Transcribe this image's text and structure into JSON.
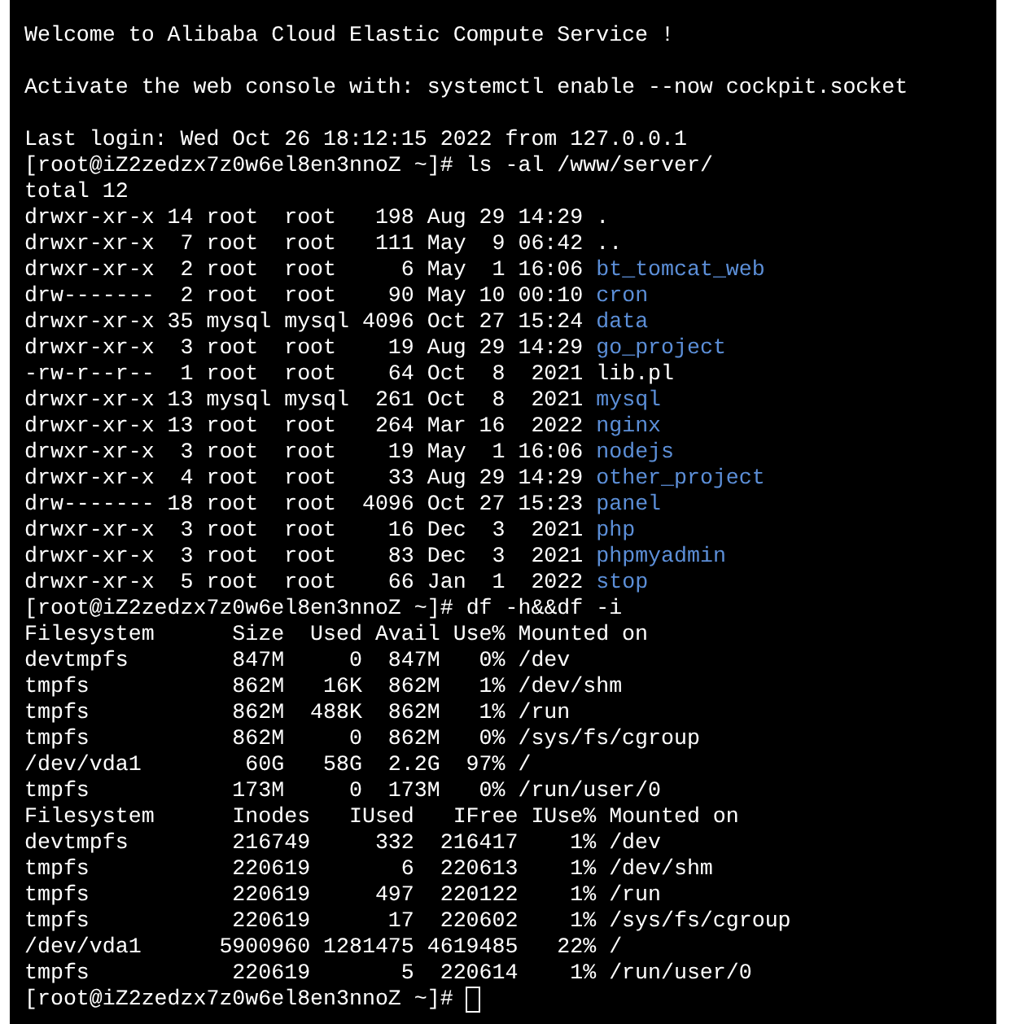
{
  "terminal": {
    "lines": [
      {
        "kind": "text",
        "text": "Welcome to Alibaba Cloud Elastic Compute Service !"
      },
      {
        "kind": "blank"
      },
      {
        "kind": "text",
        "text": "Activate the web console with: systemctl enable --now cockpit.socket"
      },
      {
        "kind": "blank"
      },
      {
        "kind": "text",
        "text": "Last login: Wed Oct 26 18:12:15 2022 from 127.0.0.1"
      },
      {
        "kind": "prompt",
        "prompt": "[root@iZ2zedzx7z0w6el8en3nnoZ ~]#",
        "command": "ls -al /www/server/",
        "cursor": false
      },
      {
        "kind": "text",
        "text": "total 12"
      },
      {
        "kind": "entry",
        "info": "drwxr-xr-x 14 root  root   198 Aug 29 14:29",
        "name": ".",
        "color": "#ffffff"
      },
      {
        "kind": "entry",
        "info": "drwxr-xr-x  7 root  root   111 May  9 06:42",
        "name": "..",
        "color": "#ffffff"
      },
      {
        "kind": "entry",
        "info": "drwxr-xr-x  2 root  root     6 May  1 16:06",
        "name": "bt_tomcat_web",
        "color": "#5c8fd8"
      },
      {
        "kind": "entry",
        "info": "drw-------  2 root  root    90 May 10 00:10",
        "name": "cron",
        "color": "#5c8fd8"
      },
      {
        "kind": "entry",
        "info": "drwxr-xr-x 35 mysql mysql 4096 Oct 27 15:24",
        "name": "data",
        "color": "#5c8fd8"
      },
      {
        "kind": "entry",
        "info": "drwxr-xr-x  3 root  root    19 Aug 29 14:29",
        "name": "go_project",
        "color": "#5c8fd8"
      },
      {
        "kind": "entry",
        "info": "-rw-r--r--  1 root  root    64 Oct  8  2021",
        "name": "lib.pl",
        "color": "#ffffff"
      },
      {
        "kind": "entry",
        "info": "drwxr-xr-x 13 mysql mysql  261 Oct  8  2021",
        "name": "mysql",
        "color": "#5c8fd8"
      },
      {
        "kind": "entry",
        "info": "drwxr-xr-x 13 root  root   264 Mar 16  2022",
        "name": "nginx",
        "color": "#5c8fd8"
      },
      {
        "kind": "entry",
        "info": "drwxr-xr-x  3 root  root    19 May  1 16:06",
        "name": "nodejs",
        "color": "#5c8fd8"
      },
      {
        "kind": "entry",
        "info": "drwxr-xr-x  4 root  root    33 Aug 29 14:29",
        "name": "other_project",
        "color": "#5c8fd8"
      },
      {
        "kind": "entry",
        "info": "drw------- 18 root  root  4096 Oct 27 15:23",
        "name": "panel",
        "color": "#5c8fd8"
      },
      {
        "kind": "entry",
        "info": "drwxr-xr-x  3 root  root    16 Dec  3  2021",
        "name": "php",
        "color": "#5c8fd8"
      },
      {
        "kind": "entry",
        "info": "drwxr-xr-x  3 root  root    83 Dec  3  2021",
        "name": "phpmyadmin",
        "color": "#5c8fd8"
      },
      {
        "kind": "entry",
        "info": "drwxr-xr-x  5 root  root    66 Jan  1  2022",
        "name": "stop",
        "color": "#5c8fd8"
      },
      {
        "kind": "prompt",
        "prompt": "[root@iZ2zedzx7z0w6el8en3nnoZ ~]#",
        "command": "df -h&&df -i",
        "cursor": false
      },
      {
        "kind": "text",
        "text": "Filesystem      Size  Used Avail Use% Mounted on"
      },
      {
        "kind": "text",
        "text": "devtmpfs        847M     0  847M   0% /dev"
      },
      {
        "kind": "text",
        "text": "tmpfs           862M   16K  862M   1% /dev/shm"
      },
      {
        "kind": "text",
        "text": "tmpfs           862M  488K  862M   1% /run"
      },
      {
        "kind": "text",
        "text": "tmpfs           862M     0  862M   0% /sys/fs/cgroup"
      },
      {
        "kind": "text",
        "text": "/dev/vda1        60G   58G  2.2G  97% /"
      },
      {
        "kind": "text",
        "text": "tmpfs           173M     0  173M   0% /run/user/0"
      },
      {
        "kind": "text",
        "text": "Filesystem      Inodes   IUsed   IFree IUse% Mounted on"
      },
      {
        "kind": "text",
        "text": "devtmpfs        216749     332  216417    1% /dev"
      },
      {
        "kind": "text",
        "text": "tmpfs           220619       6  220613    1% /dev/shm"
      },
      {
        "kind": "text",
        "text": "tmpfs           220619     497  220122    1% /run"
      },
      {
        "kind": "text",
        "text": "tmpfs           220619      17  220602    1% /sys/fs/cgroup"
      },
      {
        "kind": "text",
        "text": "/dev/vda1      5900960 1281475 4619485   22% /"
      },
      {
        "kind": "text",
        "text": "tmpfs           220619       5  220614    1% /run/user/0"
      },
      {
        "kind": "prompt",
        "prompt": "[root@iZ2zedzx7z0w6el8en3nnoZ ~]#",
        "cursor": true
      }
    ]
  }
}
